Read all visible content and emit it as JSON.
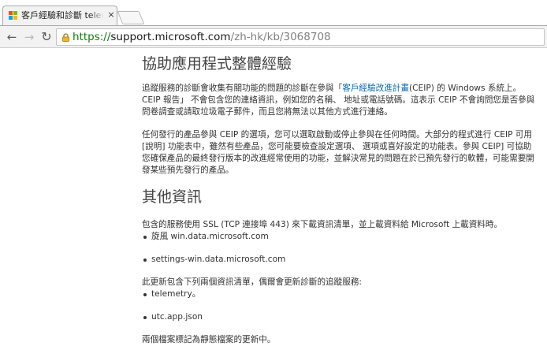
{
  "browser": {
    "tab": {
      "title": "客戶經驗和診斷 telemetry",
      "close_glyph": "×"
    },
    "nav": {
      "back_glyph": "←",
      "forward_glyph": "→",
      "reload_glyph": "↻"
    },
    "url": {
      "scheme": "https://",
      "host": "support.microsoft.com",
      "path": "/zh-hk/kb/3068708"
    },
    "favicon_colors": [
      "#f25022",
      "#7fba00",
      "#00a4ef",
      "#ffb900"
    ],
    "lock_color": "#f0b429"
  },
  "article": {
    "section1": {
      "heading": "協助應用程式整體經驗",
      "p1": {
        "before": "追蹤服務的診斷會收集有關功能的問題的診斷在參與「",
        "link": "客戶經驗改進計畫",
        "after": "(CEIP) 的 Windows 系統上。 CEIP 報告」 不會包含您的連絡資訊，例如您的名稱、 地址或電話號碼。這表示 CEIP 不會詢問您是否參與問卷調查或請取垃圾電子郵件，而且您將無法以其他方式進行連絡。"
      },
      "p2": "任何發行的產品參與 CEIP 的選項，您可以選取啟動或停止參與在任何時間。大部分的程式進行 CEIP 可用 [說明] 功能表中，雖然有些產品，您可能要檢查設定選項、 選項或喜好設定的功能表。參與 CEIP] 可協助您確保產品的最終發行版本的改進經常使用的功能，並解決常見的問題在於已預先發行的軟體，可能需要開發某些預先發行的產品。"
    },
    "section2": {
      "heading": "其他資訊",
      "p1": "包含的服務使用 SSL (TCP 連接埠 443) 來下載資訊清單，並上載資料給 Microsoft 上載資料時。",
      "list1": [
        "旋風 win.data.microsoft.com",
        "settings-win.data.microsoft.com"
      ],
      "p2": "此更新包含下列兩個資訊清單，偶爾會更新診斷的追蹤服務:",
      "list2": [
        "telemetry。",
        "utc.app.json"
      ],
      "p3": "兩個檔案標記為靜態檔案的更新中。"
    }
  },
  "colors": {
    "link": "#0067b8",
    "url_scheme": "#0b7d0b"
  }
}
